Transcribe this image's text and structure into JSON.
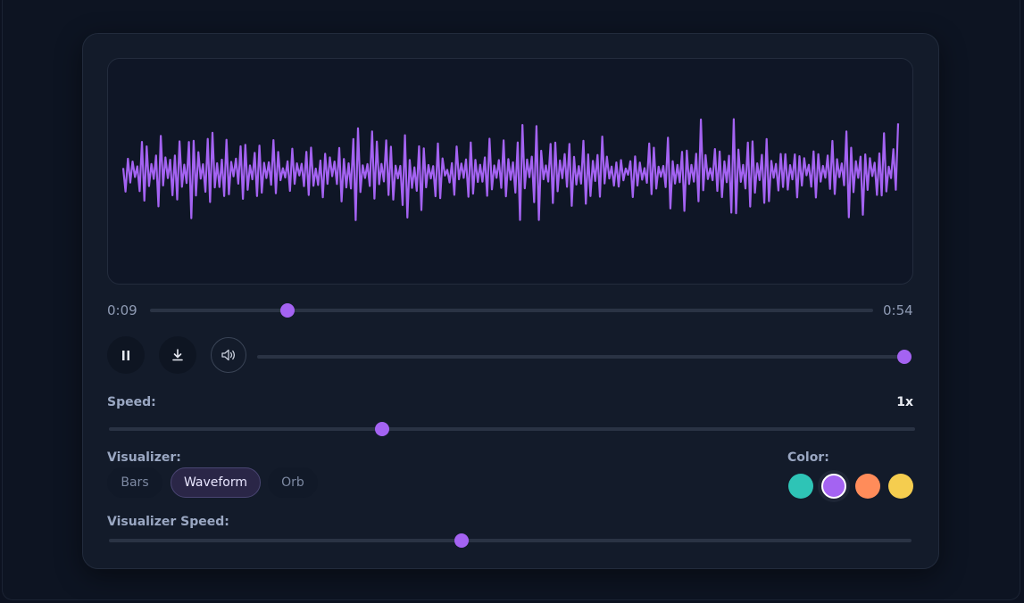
{
  "player": {
    "time_current": "0:09",
    "time_total": "0:54",
    "progress": 0.1896,
    "volume": 1.0
  },
  "controls": {
    "pause_icon": "pause-icon",
    "download_icon": "download-icon",
    "volume_icon": "speaker-icon"
  },
  "speed": {
    "label": "Speed:",
    "value_text": "1x",
    "level": 0.3385
  },
  "visualizer": {
    "label": "Visualizer:",
    "options": [
      "Bars",
      "Waveform",
      "Orb"
    ],
    "selected": "Waveform"
  },
  "color": {
    "label": "Color:",
    "swatches": [
      "#2ec4b6",
      "#a463f2",
      "#ff8c5a",
      "#f5cd4f"
    ],
    "selected": "#a463f2"
  },
  "visualizer_speed": {
    "label": "Visualizer Speed:",
    "level": 0.4394
  },
  "colors": {
    "accent": "#a463f2",
    "waveform": "#a463f2"
  }
}
